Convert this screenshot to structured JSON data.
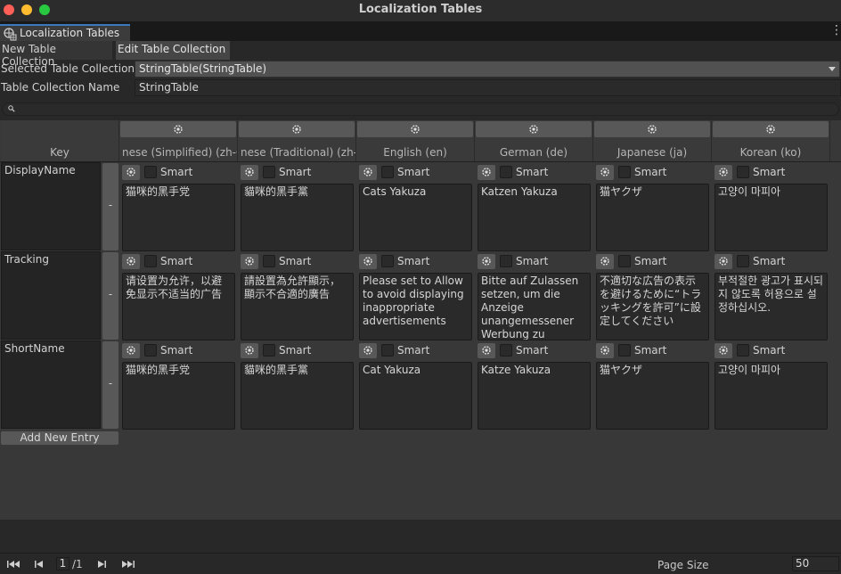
{
  "window": {
    "title": "Localization Tables"
  },
  "tab": {
    "label": "Localization Tables",
    "icon": "localization-globe-icon"
  },
  "modes": {
    "new_label": "New Table Collection",
    "edit_label": "Edit Table Collection",
    "active": "edit"
  },
  "fields": {
    "selected_label": "Selected Table Collection",
    "selected_value": "StringTable(StringTable)",
    "name_label": "Table Collection Name",
    "name_value": "StringTable"
  },
  "search": {
    "placeholder": ""
  },
  "table": {
    "key_header": "Key",
    "columns": [
      {
        "name": "nese (Simplified) (zh-C"
      },
      {
        "name": "nese (Traditional) (zh-"
      },
      {
        "name": "English (en)"
      },
      {
        "name": "German (de)"
      },
      {
        "name": "Japanese (ja)"
      },
      {
        "name": "Korean (ko)"
      }
    ],
    "smart_label": "Smart",
    "remove_label": "-",
    "rows": [
      {
        "key": "DisplayName",
        "values": [
          "猫咪的黑手党",
          "貓咪的黑手黨",
          "Cats Yakuza",
          "Katzen Yakuza",
          "猫ヤクザ",
          "고양이 마피아"
        ]
      },
      {
        "key": "Tracking",
        "values": [
          "请设置为允许，以避免显示不适当的广告",
          "請設置為允許顯示，顯示不合適的廣告",
          "Please set to Allow to avoid displaying inappropriate advertisements",
          "Bitte auf Zulassen setzen, um die Anzeige unangemessener Werbung zu",
          "不適切な広告の表示を避けるために“トラッキングを許可”に設定してください",
          "부적절한 광고가 표시되지 않도록 허용으로 설정하십시오."
        ]
      },
      {
        "key": "ShortName",
        "values": [
          "猫咪的黑手党",
          "貓咪的黑手黨",
          "Cat Yakuza",
          "Katze Yakuza",
          "猫ヤクザ",
          "고양이 마피아"
        ]
      }
    ],
    "add_entry_label": "Add New Entry"
  },
  "pagination": {
    "current_page": "1",
    "total_pages": "/1",
    "page_size_label": "Page Size",
    "page_size": "50"
  }
}
